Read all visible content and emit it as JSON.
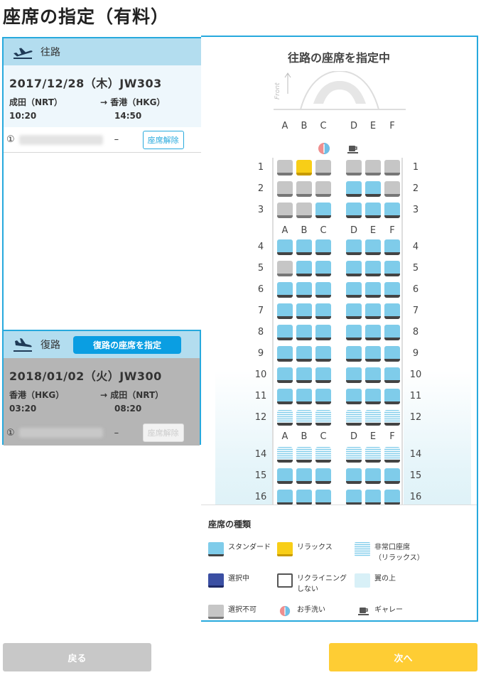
{
  "page": {
    "title": "座席の指定（有料）"
  },
  "outbound": {
    "label": "往路",
    "date_flight": "2017/12/28（木）JW303",
    "from": "成田（NRT）",
    "to": "→ 香港（HKG）",
    "dep_time": "10:20",
    "arr_time": "14:50",
    "passenger_no": "①",
    "seat": "–",
    "release_label": "座席解除"
  },
  "return": {
    "label": "復路",
    "select_button": "復路の座席を指定",
    "date_flight": "2018/01/02（火）JW300",
    "from": "香港（HKG）",
    "to": "→ 成田（NRT）",
    "dep_time": "03:20",
    "arr_time": "08:20",
    "passenger_no": "①",
    "seat": "–",
    "release_label": "座席解除"
  },
  "seat_map": {
    "title": "往路の座席を指定中",
    "front_label": "Front",
    "columns": [
      "A",
      "B",
      "C",
      "D",
      "E",
      "F"
    ],
    "rows": [
      {
        "n": "1",
        "seats": [
          "na",
          "relax",
          "na",
          "na",
          "na",
          "na"
        ]
      },
      {
        "n": "2",
        "seats": [
          "na",
          "na",
          "na",
          "std",
          "std",
          "na"
        ]
      },
      {
        "n": "3",
        "seats": [
          "na",
          "na",
          "std",
          "std",
          "std",
          "std"
        ]
      },
      {
        "n": "4",
        "seats": [
          "std",
          "std",
          "std",
          "std",
          "std",
          "std"
        ]
      },
      {
        "n": "5",
        "seats": [
          "na",
          "std",
          "std",
          "std",
          "std",
          "std"
        ]
      },
      {
        "n": "6",
        "seats": [
          "std",
          "std",
          "std",
          "std",
          "std",
          "std"
        ]
      },
      {
        "n": "7",
        "seats": [
          "std",
          "std",
          "std",
          "std",
          "std",
          "std"
        ]
      },
      {
        "n": "8",
        "seats": [
          "std",
          "std",
          "std",
          "std",
          "std",
          "std"
        ]
      },
      {
        "n": "9",
        "seats": [
          "std",
          "std",
          "std",
          "std",
          "std",
          "std"
        ]
      },
      {
        "n": "10",
        "seats": [
          "std",
          "std",
          "std",
          "std",
          "std",
          "std"
        ]
      },
      {
        "n": "11",
        "seats": [
          "std",
          "std",
          "std",
          "std",
          "std",
          "std"
        ]
      },
      {
        "n": "12",
        "seats": [
          "exit",
          "exit",
          "exit",
          "exit",
          "exit",
          "exit"
        ]
      },
      {
        "n": "14",
        "seats": [
          "exit",
          "exit",
          "exit",
          "exit",
          "exit",
          "exit"
        ]
      },
      {
        "n": "15",
        "seats": [
          "std",
          "std",
          "std",
          "std",
          "std",
          "std"
        ]
      },
      {
        "n": "16",
        "seats": [
          "std",
          "std",
          "std",
          "std",
          "std",
          "std"
        ]
      }
    ],
    "icons": {
      "lavatory": "lavatory-icon",
      "galley": "galley-icon"
    }
  },
  "legend": {
    "title": "座席の種類",
    "standard": "スタンダード",
    "relax": "リラックス",
    "exit_1": "非常口座席",
    "exit_2": "（リラックス）",
    "selected": "選択中",
    "norecline_1": "リクライニング",
    "norecline_2": "しない",
    "wing": "翼の上",
    "unavailable": "選択不可",
    "lavatory": "お手洗い",
    "galley": "ギャレー"
  },
  "colors": {
    "accent": "#27a9dd",
    "standard": "#7fccea",
    "relax": "#f8ce17",
    "selected": "#3b4fa3",
    "unavailable": "#c6c6c6",
    "next": "#fecd34"
  },
  "footer": {
    "back": "戻る",
    "next": "次へ"
  }
}
